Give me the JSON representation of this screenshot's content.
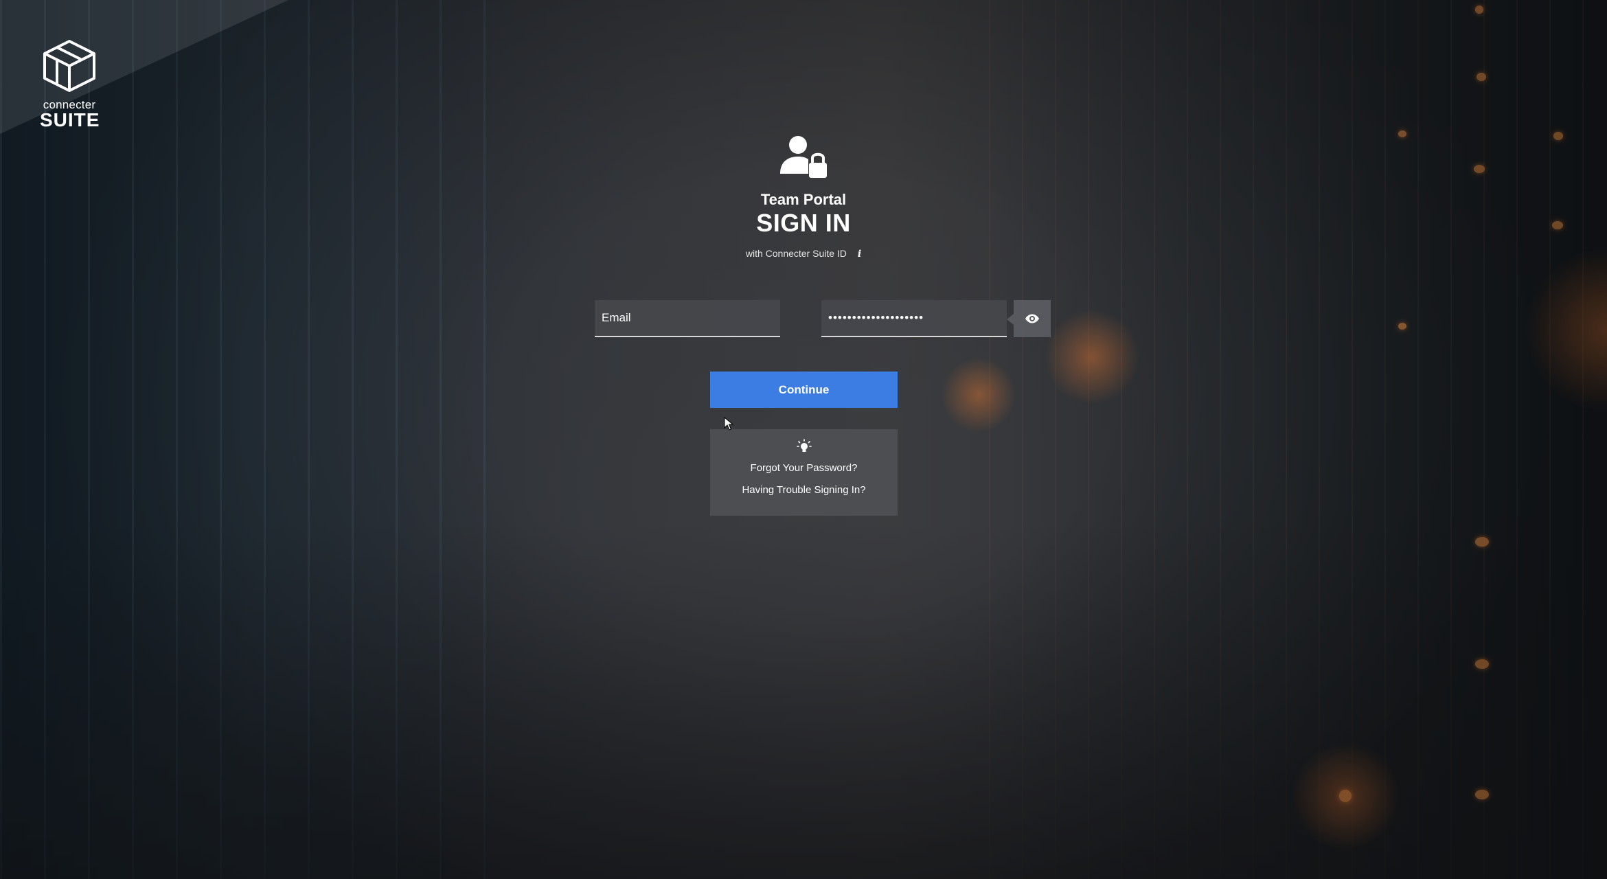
{
  "brand": {
    "name_top": "connecter",
    "name_bottom": "SUITE",
    "logo_icon": "cube-icon"
  },
  "header": {
    "icon": "user-lock-icon",
    "portal": "Team Portal",
    "title": "SIGN IN",
    "subtitle": "with Connecter Suite ID",
    "info_icon": "i"
  },
  "form": {
    "email_placeholder": "Email",
    "email_value": "",
    "password_value": "••••••••••••••••••••",
    "show_password_icon": "eye-icon",
    "continue_label": "Continue"
  },
  "help": {
    "icon": "lightbulb-icon",
    "forgot_password": "Forgot Your Password?",
    "trouble_signing_in": "Having Trouble Signing In?"
  },
  "colors": {
    "accent": "#3b7de3",
    "panel": "#4e5054",
    "text": "#ffffff"
  }
}
